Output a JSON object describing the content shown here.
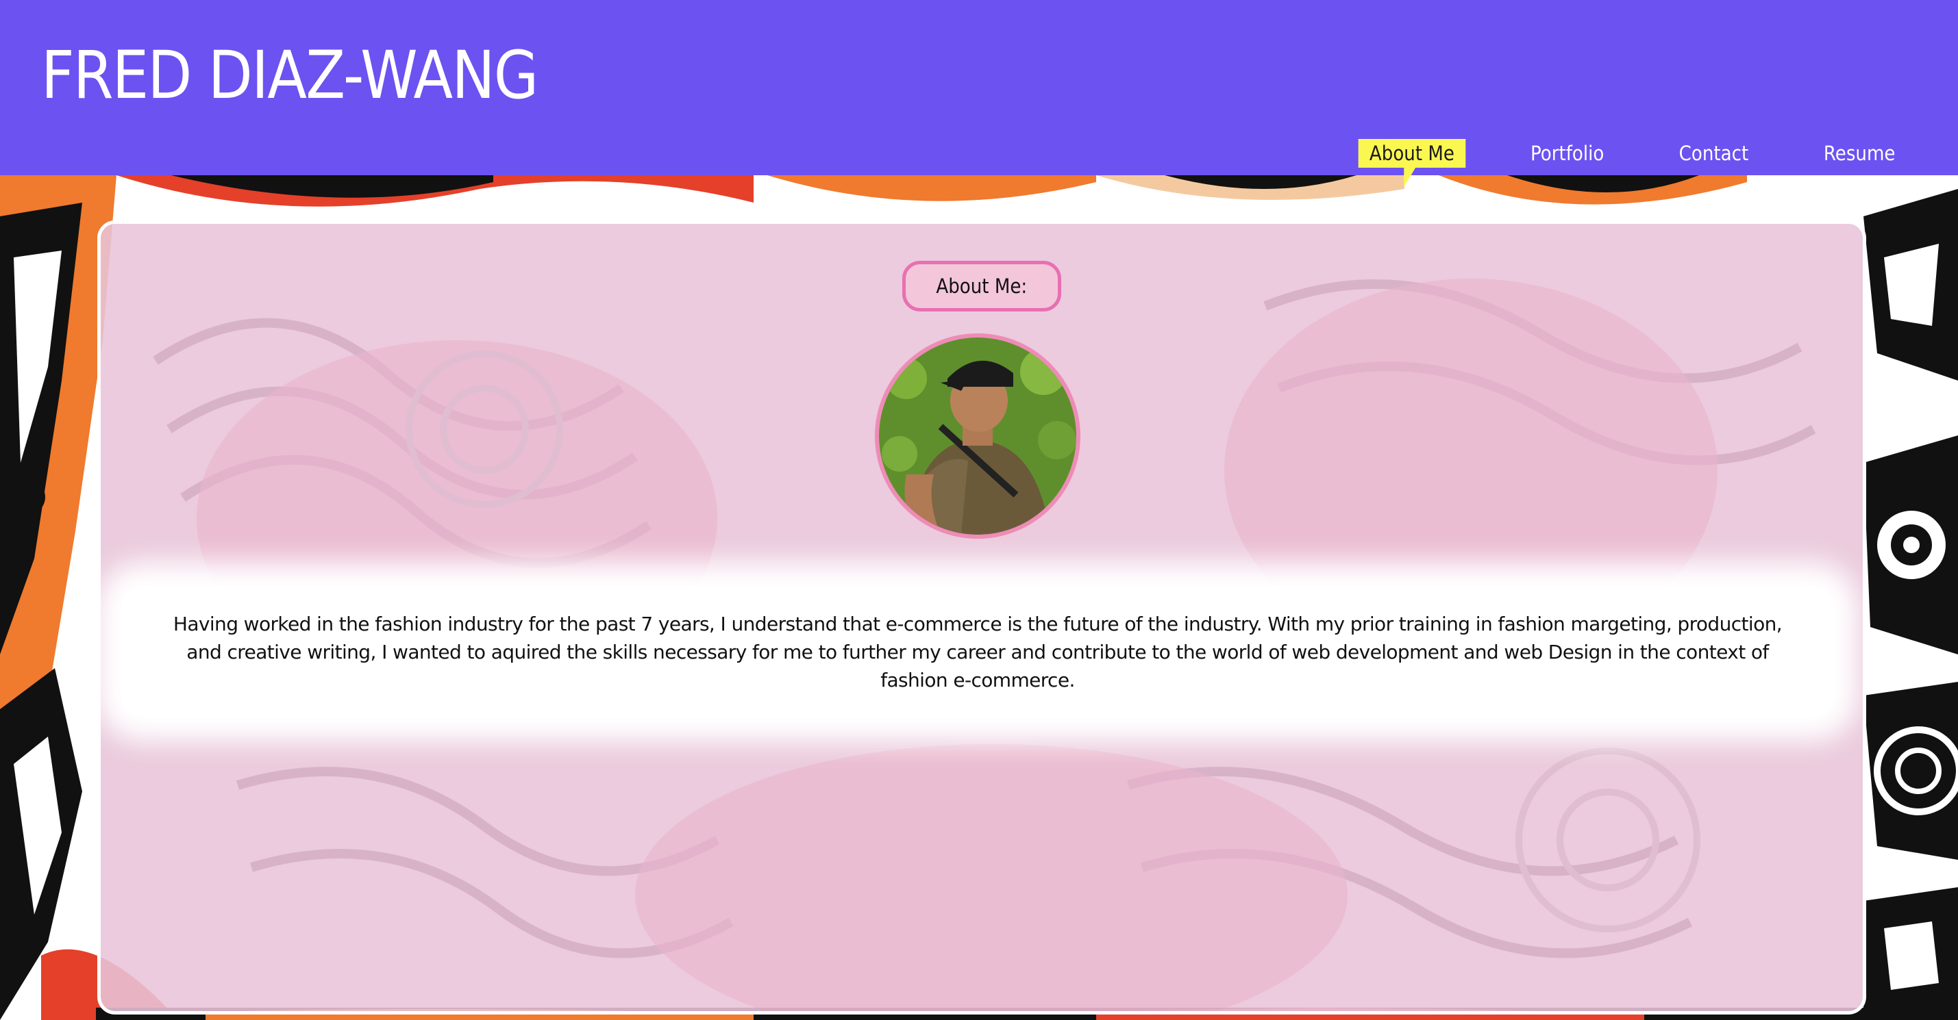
{
  "header": {
    "title": "FRED DIAZ-WANG",
    "background_color": "#6c52f1"
  },
  "nav": {
    "items": [
      {
        "label": "About Me",
        "active": true
      },
      {
        "label": "Portfolio",
        "active": false
      },
      {
        "label": "Contact",
        "active": false
      },
      {
        "label": "Resume",
        "active": false
      }
    ],
    "active_highlight_color": "#fbf751"
  },
  "main": {
    "section_label": "About Me:",
    "avatar_icon": "profile-photo",
    "about_text": "Having worked in the fashion industry for the past 7 years, I understand that e-commerce is the future of the industry. With my prior training in fashion margeting, production, and creative writing, I wanted to aquired the skills necessary for me to further my career and contribute to the world of web development and web Design in the context of fashion e-commerce.",
    "card_color": "#e8c4d8",
    "accent_pink": "#e86fb2"
  }
}
